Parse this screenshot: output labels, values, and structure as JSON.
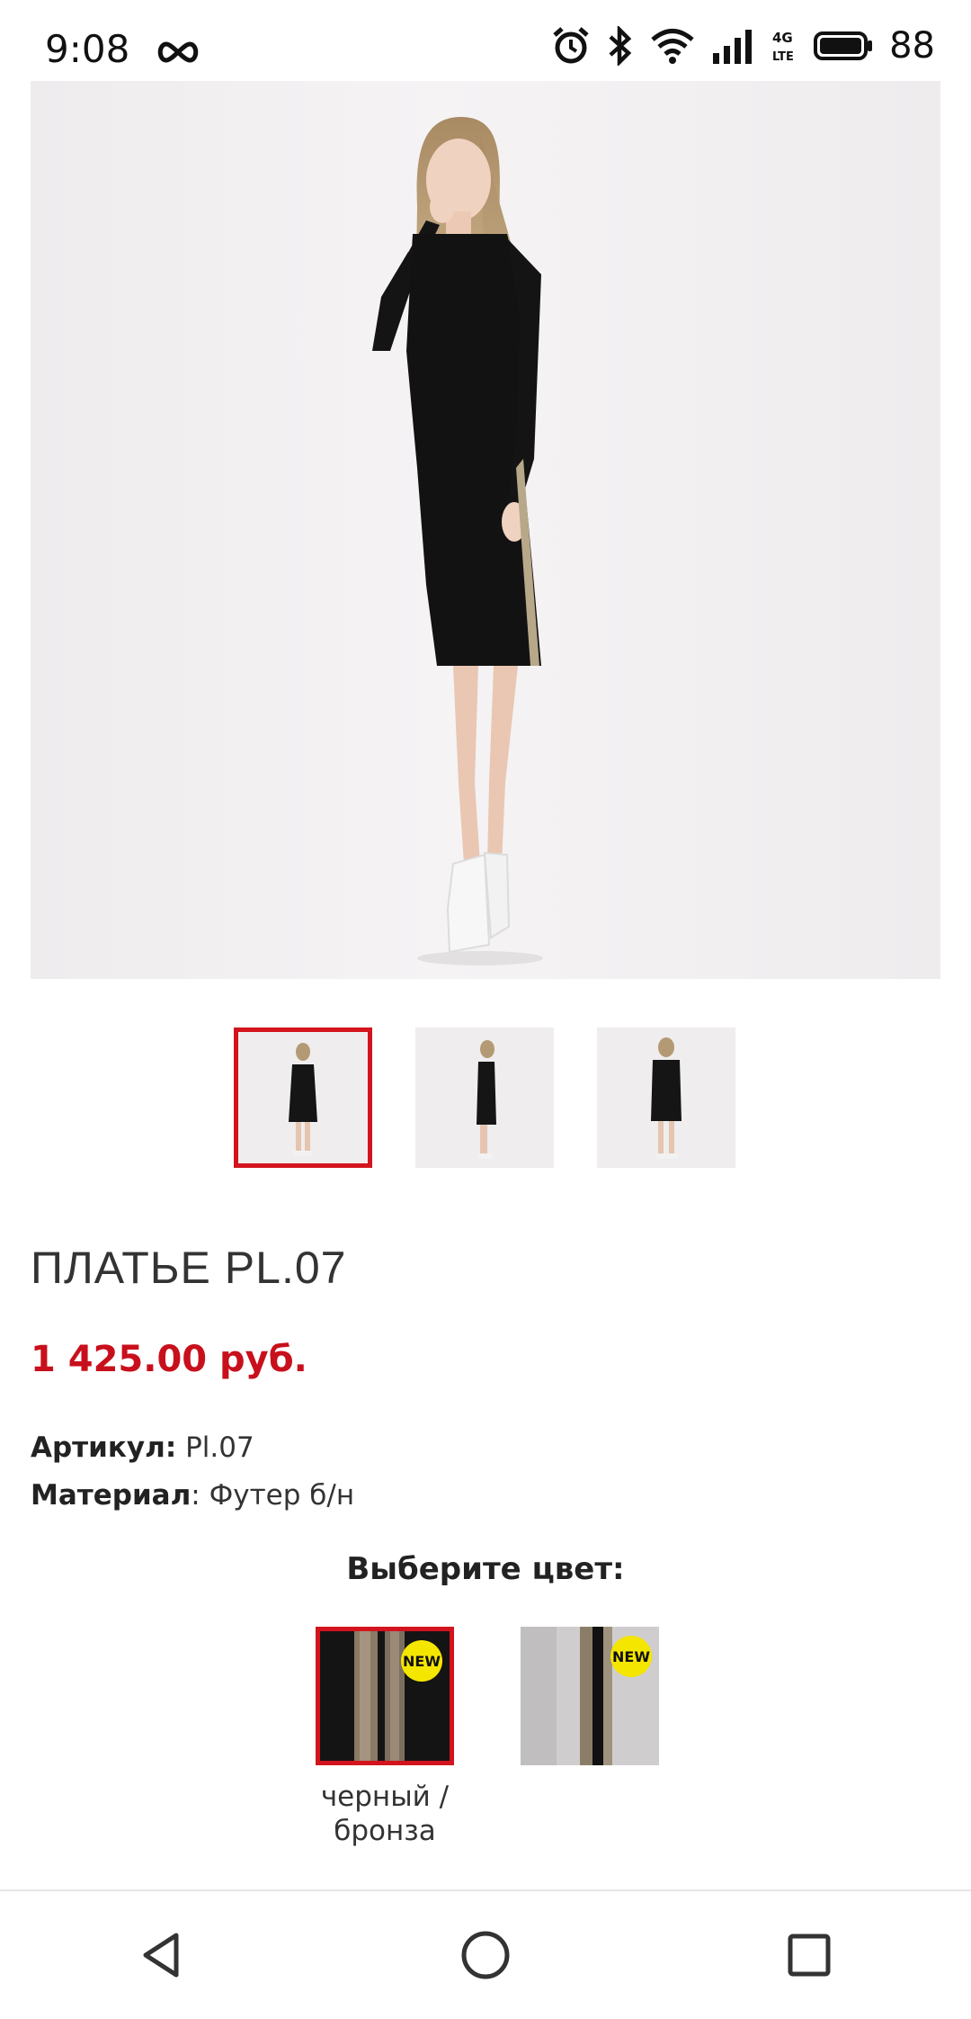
{
  "status": {
    "time": "9:08",
    "battery": "88"
  },
  "product": {
    "title": "ПЛАТЬЕ PL.07",
    "price": "1 425.00 руб.",
    "article_label": "Артикул:",
    "article_value": " Pl.07",
    "material_label": "Материал",
    "material_value": ": Футер б/н"
  },
  "color_picker": {
    "heading": "Выберите цвет:",
    "options": [
      {
        "label": "черный / бронза",
        "badge": "NEW",
        "selected": true,
        "color": "#1a1a1a"
      },
      {
        "label": "",
        "badge": "NEW",
        "selected": false,
        "color": "#c9c7c7"
      }
    ]
  },
  "thumbnails": [
    "front",
    "side",
    "back"
  ],
  "colors": {
    "accent": "#d3141e",
    "price": "#c8101c",
    "badge": "#f5e600"
  },
  "icons": [
    "infinity-icon",
    "alarm-icon",
    "bluetooth-icon",
    "wifi-icon",
    "signal-icon",
    "lte-icon",
    "battery-icon",
    "back-icon",
    "home-icon",
    "recents-icon"
  ]
}
